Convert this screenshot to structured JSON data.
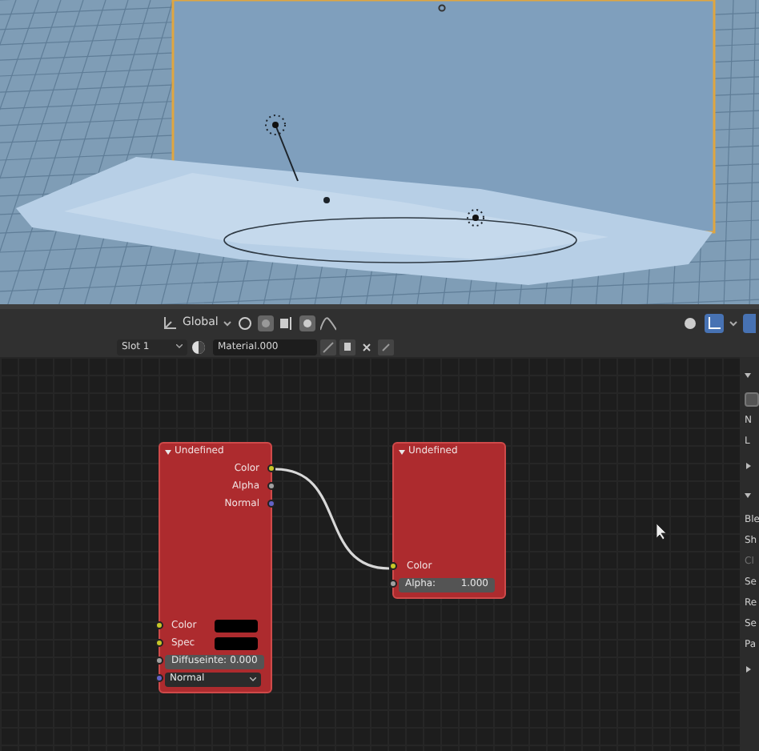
{
  "viewport_header": {
    "orientation": "Global"
  },
  "material_bar": {
    "slot": "Slot 1",
    "material": "Material.000"
  },
  "nodes": [
    {
      "title": "Undefined",
      "outputs": [
        {
          "label": "Color",
          "color": "#c7c729"
        },
        {
          "label": "Alpha",
          "color": "#a1a1a1"
        },
        {
          "label": "Normal",
          "color": "#6363c7"
        }
      ],
      "inputs": [
        {
          "kind": "color",
          "label": "Color",
          "color": "#c7c729"
        },
        {
          "kind": "color",
          "label": "Spec",
          "color": "#c7c729"
        },
        {
          "kind": "value",
          "label": "Diffuseinte:",
          "value": "0.000",
          "color": "#a1a1a1"
        },
        {
          "kind": "menu",
          "value": "Normal",
          "color": "#6363c7"
        }
      ]
    },
    {
      "title": "Undefined",
      "inputs": [
        {
          "kind": "label",
          "label": "Color",
          "color": "#c7c729"
        },
        {
          "kind": "value",
          "label": "Alpha:",
          "value": "1.000",
          "color": "#a1a1a1"
        }
      ]
    }
  ],
  "sidebar": [
    {
      "kind": "header",
      "expanded": true
    },
    {
      "kind": "icon"
    },
    {
      "kind": "text",
      "text": "N",
      "disabled": false
    },
    {
      "kind": "text",
      "text": "L",
      "disabled": false
    },
    {
      "kind": "header",
      "expanded": false
    },
    {
      "kind": "header",
      "expanded": true
    },
    {
      "kind": "text",
      "text": "Ble",
      "disabled": false
    },
    {
      "kind": "text",
      "text": "Sh",
      "disabled": false
    },
    {
      "kind": "text",
      "text": "Cl",
      "disabled": true
    },
    {
      "kind": "text",
      "text": "Se",
      "disabled": false
    },
    {
      "kind": "text",
      "text": "Re",
      "disabled": false
    },
    {
      "kind": "text",
      "text": "Se",
      "disabled": false
    },
    {
      "kind": "text",
      "text": "Pa",
      "disabled": false
    },
    {
      "kind": "header",
      "expanded": false
    }
  ]
}
